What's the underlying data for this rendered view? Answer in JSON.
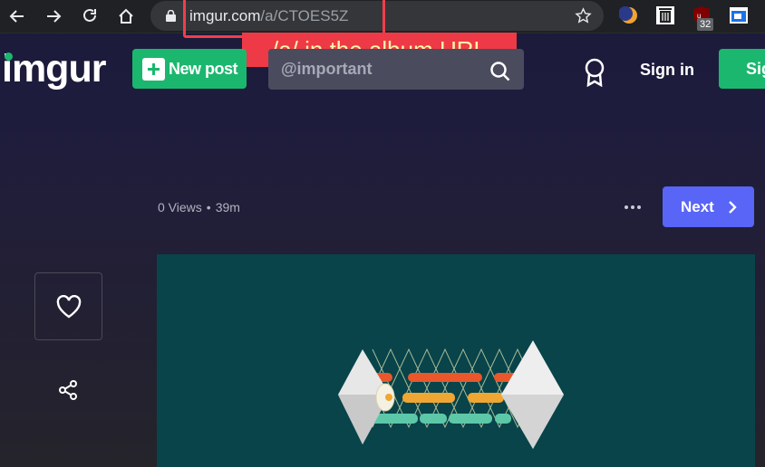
{
  "browser": {
    "url_domain": "imgur.com",
    "url_path": "/a/CTOES5Z",
    "ublock_count": "32"
  },
  "annotation": {
    "label": "/a/ in the album URL"
  },
  "header": {
    "logo": "imgur",
    "new_post_label": "New post",
    "search_value": "@important",
    "signin_label": "Sign in",
    "signup_label": "Sig"
  },
  "post": {
    "views": "0 Views",
    "separator": "•",
    "age": "39m",
    "next_label": "Next"
  },
  "colors": {
    "brand_green": "#1bb76e",
    "next_blue": "#5865f7",
    "annotation_red": "#ee3a46",
    "image_bg": "#08444a"
  }
}
